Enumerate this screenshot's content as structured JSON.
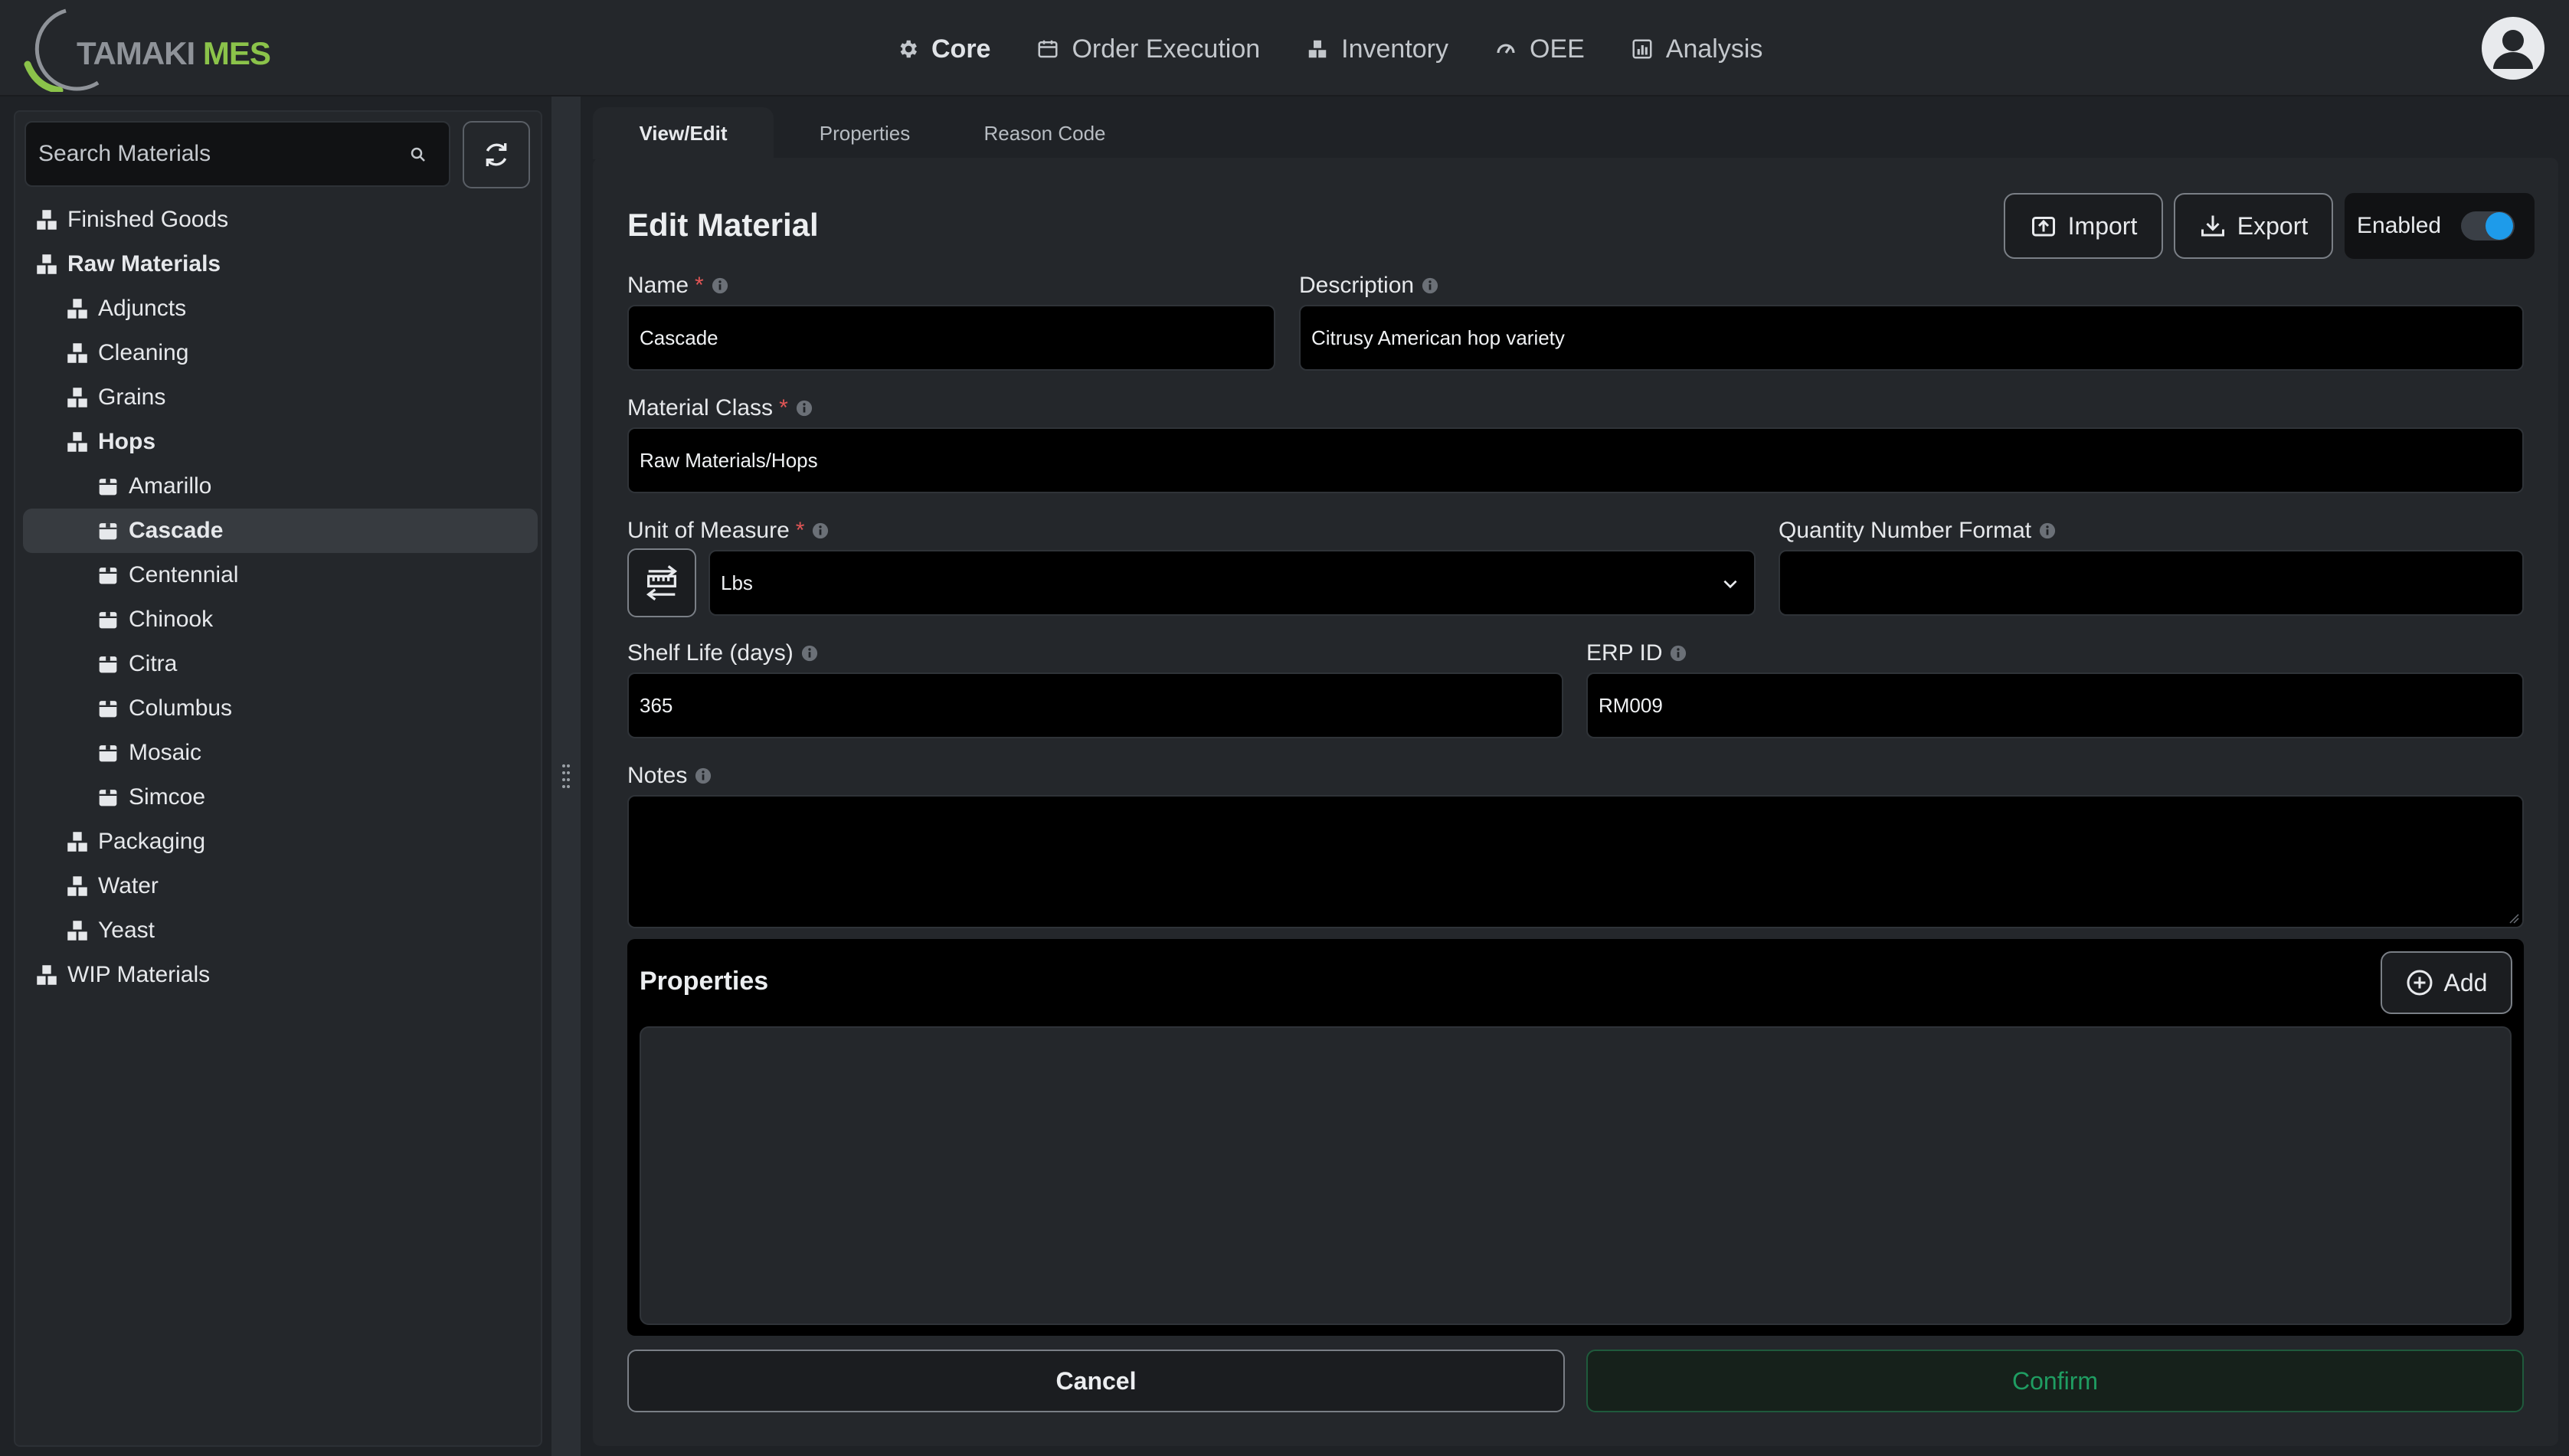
{
  "app": {
    "logo_text_1": "TAMAKI",
    "logo_text_2": "MES",
    "nav": [
      {
        "label": "Core",
        "icon": "gear-icon"
      },
      {
        "label": "Order Execution",
        "icon": "calendar-icon"
      },
      {
        "label": "Inventory",
        "icon": "boxes-icon"
      },
      {
        "label": "OEE",
        "icon": "gauge-icon"
      },
      {
        "label": "Analysis",
        "icon": "chart-icon"
      }
    ],
    "active_nav": "Core"
  },
  "sidebar": {
    "search_placeholder": "Search Materials",
    "tree": [
      {
        "label": "Finished Goods",
        "level": 0,
        "type": "class"
      },
      {
        "label": "Raw Materials",
        "level": 0,
        "type": "class",
        "bold": true
      },
      {
        "label": "Adjuncts",
        "level": 1,
        "type": "class"
      },
      {
        "label": "Cleaning",
        "level": 1,
        "type": "class"
      },
      {
        "label": "Grains",
        "level": 1,
        "type": "class"
      },
      {
        "label": "Hops",
        "level": 1,
        "type": "class",
        "bold": true
      },
      {
        "label": "Amarillo",
        "level": 2,
        "type": "material"
      },
      {
        "label": "Cascade",
        "level": 2,
        "type": "material",
        "selected": true
      },
      {
        "label": "Centennial",
        "level": 2,
        "type": "material"
      },
      {
        "label": "Chinook",
        "level": 2,
        "type": "material"
      },
      {
        "label": "Citra",
        "level": 2,
        "type": "material"
      },
      {
        "label": "Columbus",
        "level": 2,
        "type": "material"
      },
      {
        "label": "Mosaic",
        "level": 2,
        "type": "material"
      },
      {
        "label": "Simcoe",
        "level": 2,
        "type": "material"
      },
      {
        "label": "Packaging",
        "level": 1,
        "type": "class"
      },
      {
        "label": "Water",
        "level": 1,
        "type": "class"
      },
      {
        "label": "Yeast",
        "level": 1,
        "type": "class"
      },
      {
        "label": "WIP Materials",
        "level": 0,
        "type": "class"
      }
    ]
  },
  "tabs": [
    "View/Edit",
    "Properties",
    "Reason Code"
  ],
  "active_tab": "View/Edit",
  "form": {
    "title": "Edit Material",
    "import_label": "Import",
    "export_label": "Export",
    "enabled_label": "Enabled",
    "enabled": true,
    "name_label": "Name",
    "name_value": "Cascade",
    "description_label": "Description",
    "description_value": "Citrusy American hop variety",
    "material_class_label": "Material Class",
    "material_class_value": "Raw Materials/Hops",
    "uom_label": "Unit of Measure",
    "uom_value": "Lbs",
    "qty_format_label": "Quantity Number Format",
    "qty_format_value": "",
    "shelf_life_label": "Shelf Life (days)",
    "shelf_life_value": "365",
    "erp_id_label": "ERP ID",
    "erp_id_value": "RM009",
    "notes_label": "Notes",
    "notes_value": "",
    "required_mark": "*",
    "properties_title": "Properties",
    "add_label": "Add",
    "cancel_label": "Cancel",
    "confirm_label": "Confirm"
  },
  "colors": {
    "accent_green": "#8bc34a",
    "toggle_blue": "#1e9bea",
    "confirm_green": "#1f9d62",
    "required_red": "#e05555"
  }
}
